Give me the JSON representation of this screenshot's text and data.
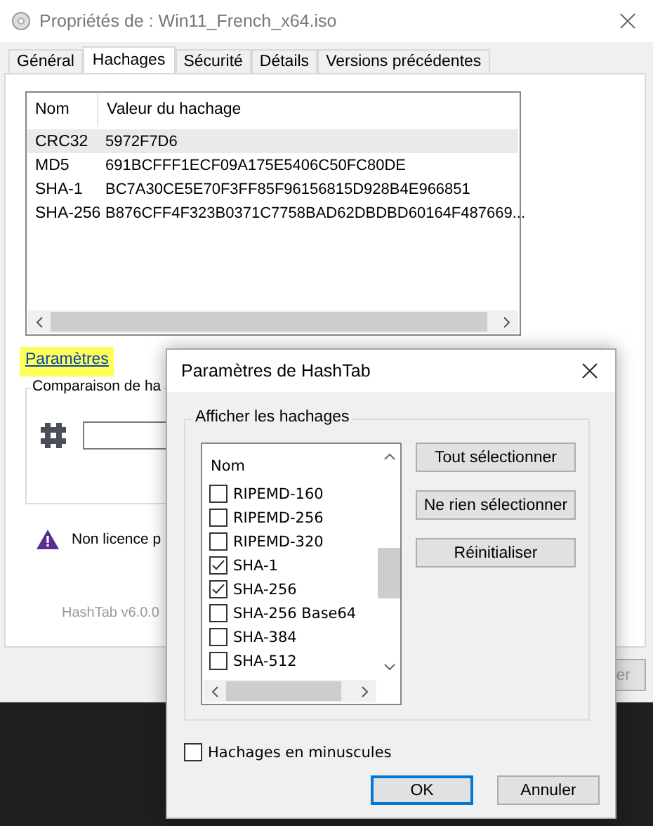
{
  "window": {
    "title": "Propriétés de : Win11_French_x64.iso"
  },
  "tabs": [
    {
      "label": "Général",
      "selected": false
    },
    {
      "label": "Hachages",
      "selected": true
    },
    {
      "label": "Sécurité",
      "selected": false
    },
    {
      "label": "Détails",
      "selected": false
    },
    {
      "label": "Versions précédentes",
      "selected": false
    }
  ],
  "hash_table": {
    "columns": [
      "Nom",
      "Valeur du hachage"
    ],
    "rows": [
      {
        "name": "CRC32",
        "value": "5972F7D6",
        "selected": true
      },
      {
        "name": "MD5",
        "value": "691BCFFF1ECF09A175E5406C50FC80DE",
        "selected": false
      },
      {
        "name": "SHA-1",
        "value": "BC7A30CE5E70F3FF85F96156815D928B4E966851",
        "selected": false
      },
      {
        "name": "SHA-256",
        "value": "B876CFF4F323B0371C7758BAD62DBDBD60164F487669...",
        "selected": false
      }
    ]
  },
  "settings_link": "Paramètres",
  "comparison_group": {
    "label": "Comparaison de ha"
  },
  "license_notice": "Non licence p",
  "version": "HashTab v6.0.0",
  "footer_button": "er",
  "dialog": {
    "title": "Paramètres de HashTab",
    "group_label": "Afficher les hachages",
    "list_header": "Nom",
    "items": [
      {
        "label": "RIPEMD-160",
        "checked": false
      },
      {
        "label": "RIPEMD-256",
        "checked": false
      },
      {
        "label": "RIPEMD-320",
        "checked": false
      },
      {
        "label": "SHA-1",
        "checked": true
      },
      {
        "label": "SHA-256",
        "checked": true
      },
      {
        "label": "SHA-256 Base64",
        "checked": false
      },
      {
        "label": "SHA-384",
        "checked": false
      },
      {
        "label": "SHA-512",
        "checked": false
      }
    ],
    "side_buttons": [
      "Tout sélectionner",
      "Ne rien sélectionner",
      "Réinitialiser"
    ],
    "lowercase": {
      "label": "Hachages en minuscules",
      "checked": false
    },
    "buttons": [
      {
        "label": "OK",
        "kind": "default"
      },
      {
        "label": "Annuler",
        "kind": "normal"
      }
    ]
  }
}
